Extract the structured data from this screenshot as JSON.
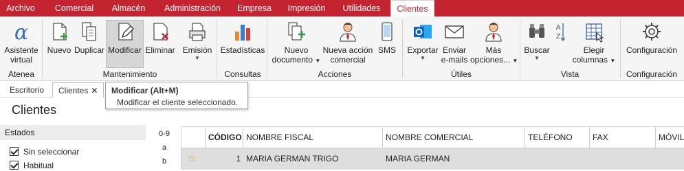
{
  "menubar": {
    "items": [
      "Archivo",
      "Comercial",
      "Almacén",
      "Administración",
      "Empresa",
      "Impresión",
      "Utilidades",
      "Clientes"
    ],
    "active": "Clientes"
  },
  "ribbon": {
    "atenea": {
      "button": "Asistente virtual",
      "line1": "Asistente",
      "line2": "virtual",
      "group": "Atenea"
    },
    "mantenimiento": {
      "nuevo": "Nuevo",
      "duplicar": "Duplicar",
      "modificar": "Modificar",
      "eliminar": "Eliminar",
      "emision": "Emisión",
      "group": "Mantenimiento"
    },
    "consultas": {
      "estadisticas": "Estadísticas",
      "group": "Consultas"
    },
    "acciones": {
      "nuevo_doc_1": "Nuevo",
      "nuevo_doc_2": "documento",
      "nueva_accion_1": "Nueva acción",
      "nueva_accion_2": "comercial",
      "sms": "SMS",
      "group": "Acciones"
    },
    "utiles": {
      "exportar": "Exportar",
      "enviar_1": "Enviar",
      "enviar_2": "e-mails",
      "mas_1": "Más",
      "mas_2": "opciones...",
      "group": "Útiles"
    },
    "vista": {
      "buscar": "Buscar",
      "elegir_1": "Elegir",
      "elegir_2": "columnas",
      "group": "Vista"
    },
    "configuracion": {
      "button": "Configuración",
      "group": "Configuración"
    }
  },
  "tabs": [
    {
      "label": "Escritorio"
    },
    {
      "label": "Clientes",
      "close": "✕"
    }
  ],
  "tooltip": {
    "title": "Modificar (Alt+M)",
    "text": "Modificar el cliente seleccionado."
  },
  "page": {
    "title": "Clientes"
  },
  "states": {
    "header": "Estados",
    "items": [
      {
        "label": "Sin seleccionar",
        "checked": true
      },
      {
        "label": "Habitual",
        "checked": true
      }
    ]
  },
  "alpha_index": [
    "0-9",
    "a",
    "b"
  ],
  "grid": {
    "columns": [
      "CÓDIGO",
      "NOMBRE FISCAL",
      "NOMBRE COMERCIAL",
      "TELÉFONO",
      "FAX",
      "MÓVIL"
    ],
    "rows": [
      {
        "favorite": "☆",
        "codigo": "1",
        "nombre_fiscal": "MARIA GERMAN TRIGO",
        "nombre_comercial": "MARIA GERMAN",
        "telefono": "",
        "fax": "",
        "movil": ""
      }
    ]
  },
  "colors": {
    "brand": "#c4242f",
    "row_selected": "#dedede",
    "star": "#e8a33c"
  }
}
